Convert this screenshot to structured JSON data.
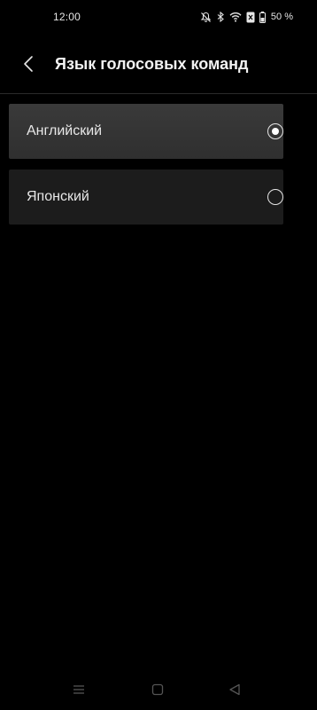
{
  "status_bar": {
    "time": "12:00",
    "battery_percent": "50 %",
    "icons": [
      "mute-icon",
      "bluetooth-icon",
      "wifi-icon",
      "sim-off-icon",
      "battery-icon"
    ]
  },
  "header": {
    "title": "Язык голосовых команд",
    "back_icon": "chevron-left-icon"
  },
  "options": [
    {
      "label": "Английский",
      "selected": true
    },
    {
      "label": "Японский",
      "selected": false
    }
  ],
  "nav_bar": {
    "icons": [
      "menu-icon",
      "home-square-icon",
      "back-triangle-icon"
    ]
  },
  "colors": {
    "background": "#000000",
    "selected_row": "#353535",
    "unselected_row": "#1c1c1c",
    "text": "#e8e8e8",
    "divider": "#2a2a2a"
  }
}
